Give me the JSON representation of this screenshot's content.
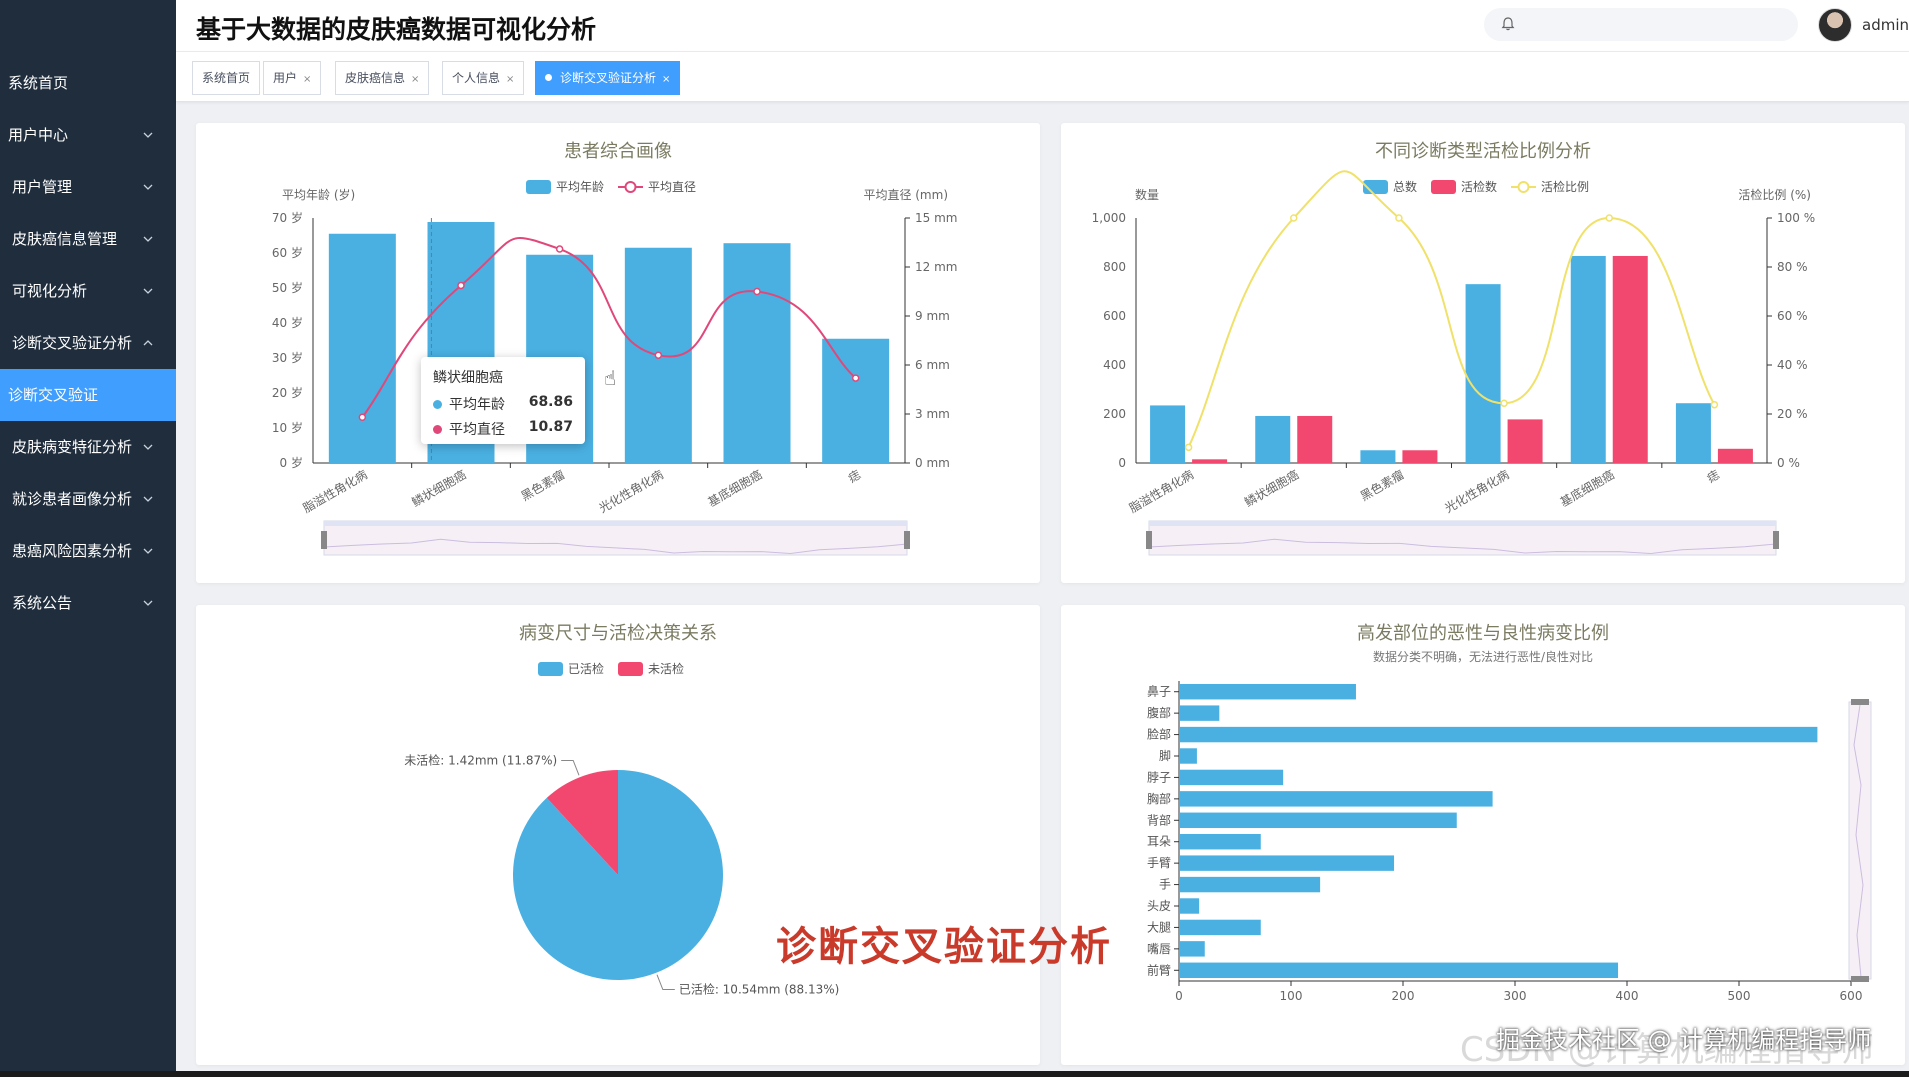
{
  "app": {
    "title": "基于大数据的皮肤癌数据可视化分析",
    "username": "admin"
  },
  "sidebar": {
    "items": [
      {
        "label": "系统首页",
        "has_arrow": false
      },
      {
        "label": "用户中心",
        "has_arrow": true,
        "arrow": "down"
      },
      {
        "label": "用户管理",
        "has_arrow": true,
        "arrow": "down"
      },
      {
        "label": "皮肤癌信息管理",
        "has_arrow": true,
        "arrow": "down"
      },
      {
        "label": "可视化分析",
        "has_arrow": true,
        "arrow": "down"
      },
      {
        "label": "诊断交叉验证分析",
        "has_arrow": true,
        "arrow": "up"
      },
      {
        "label": "诊断交叉验证",
        "has_arrow": false,
        "active": true
      },
      {
        "label": "皮肤病变特征分析",
        "has_arrow": true,
        "arrow": "down"
      },
      {
        "label": "就诊患者画像分析",
        "has_arrow": true,
        "arrow": "down"
      },
      {
        "label": "患癌风险因素分析",
        "has_arrow": true,
        "arrow": "down"
      },
      {
        "label": "系统公告",
        "has_arrow": true,
        "arrow": "down"
      }
    ],
    "bg_color": "#1f2d3d",
    "active_color": "#409eff"
  },
  "tabs": [
    {
      "label": "系统首页",
      "closable": false
    },
    {
      "label": "用户",
      "closable": true
    },
    {
      "label": "皮肤癌信息",
      "closable": true
    },
    {
      "label": "个人信息",
      "closable": true
    },
    {
      "label": "诊断交叉验证分析",
      "closable": true,
      "active": true
    }
  ],
  "tab_close_glyph": "×",
  "icons": {
    "notification": "bell-icon",
    "avatar": "user-avatar",
    "menu_arrow": "chevron-icon"
  },
  "tooltip": {
    "title": "鳞状细胞癌",
    "rows": [
      {
        "name": "平均年龄",
        "value": "68.86",
        "color": "#4ab0e2"
      },
      {
        "name": "平均直径",
        "value": "10.87",
        "color": "#e0487a"
      }
    ]
  },
  "overlay_caption": "诊断交叉验证分析",
  "watermarks": {
    "csdn": "CSDN @计算机编程指导师",
    "juejin": "掘金技术社区 @ 计算机编程指导师"
  },
  "chart_data": [
    {
      "id": "profile",
      "type": "bar",
      "title": "患者综合画像",
      "categories": [
        "脂溢性角化病",
        "鳞状细胞癌",
        "黑色素瘤",
        "光化性角化病",
        "基底细胞癌",
        "痣"
      ],
      "series": [
        {
          "name": "平均年龄",
          "type": "bar",
          "axis": "left",
          "color": "#4ab0e2",
          "values": [
            65.5,
            68.86,
            59.5,
            61.5,
            62.8,
            35.5
          ]
        },
        {
          "name": "平均直径",
          "type": "line",
          "axis": "right",
          "color": "#e0487a",
          "values": [
            2.8,
            10.87,
            13.1,
            6.6,
            10.5,
            5.2
          ]
        }
      ],
      "ylabel": "平均年龄 (岁)",
      "ylabel_right": "平均直径 (mm)",
      "y_ticks": [
        "0 岁",
        "10 岁",
        "20 岁",
        "30 岁",
        "40 岁",
        "50 岁",
        "60 岁",
        "70 岁"
      ],
      "y_right_ticks": [
        "0 mm",
        "3 mm",
        "6 mm",
        "9 mm",
        "12 mm",
        "15 mm"
      ],
      "ylim": [
        0,
        70
      ],
      "ylim_right": [
        0,
        15
      ],
      "legend": "top-center",
      "data_zoom": true
    },
    {
      "id": "biopsy",
      "type": "bar",
      "title": "不同诊断类型活检比例分析",
      "categories": [
        "脂溢性角化病",
        "鳞状细胞癌",
        "黑色素瘤",
        "光化性角化病",
        "基底细胞癌",
        "痣"
      ],
      "series": [
        {
          "name": "总数",
          "type": "bar",
          "axis": "left",
          "color": "#4ab0e2",
          "values": [
            235,
            192,
            52,
            730,
            845,
            244
          ]
        },
        {
          "name": "活检数",
          "type": "bar",
          "axis": "left",
          "color": "#f2486f",
          "values": [
            15,
            192,
            52,
            178,
            845,
            58
          ]
        },
        {
          "name": "活检比例",
          "type": "line",
          "axis": "right",
          "color": "#f0e16a",
          "values": [
            6.4,
            100,
            100,
            24.4,
            100,
            23.8
          ]
        }
      ],
      "ylabel": "数量",
      "ylabel_right": "活检比例 (%)",
      "y_ticks": [
        "0",
        "200",
        "400",
        "600",
        "800",
        "1,000"
      ],
      "y_right_ticks": [
        "0 %",
        "20 %",
        "40 %",
        "60 %",
        "80 %",
        "100 %"
      ],
      "ylim": [
        0,
        1000
      ],
      "ylim_right": [
        0,
        100
      ],
      "legend": "top-center",
      "data_zoom": true
    },
    {
      "id": "pie",
      "type": "pie",
      "title": "病变尺寸与活检决策关系",
      "slices": [
        {
          "name": "已活检",
          "value": 10.54,
          "percent": 88.13,
          "color": "#4ab0e2",
          "label": "已活检: 10.54mm (88.13%)"
        },
        {
          "name": "未活检",
          "value": 1.42,
          "percent": 11.87,
          "color": "#f2486f",
          "label": "未活检: 1.42mm (11.87%)"
        }
      ],
      "legend": "top-center"
    },
    {
      "id": "sites",
      "type": "bar",
      "orientation": "horizontal",
      "title": "高发部位的恶性与良性病变比例",
      "subtitle": "数据分类不明确，无法进行恶性/良性对比",
      "categories": [
        "鼻子",
        "腹部",
        "脸部",
        "脚",
        "脖子",
        "胸部",
        "背部",
        "耳朵",
        "手臂",
        "手",
        "头皮",
        "大腿",
        "嘴唇",
        "前臂"
      ],
      "values": [
        158,
        36,
        570,
        16,
        93,
        280,
        248,
        73,
        192,
        126,
        18,
        73,
        23,
        392
      ],
      "color": "#4ab0e2",
      "x_ticks": [
        "0",
        "100",
        "200",
        "300",
        "400",
        "500",
        "600"
      ],
      "xlim": [
        0,
        600
      ],
      "data_zoom": true
    }
  ]
}
